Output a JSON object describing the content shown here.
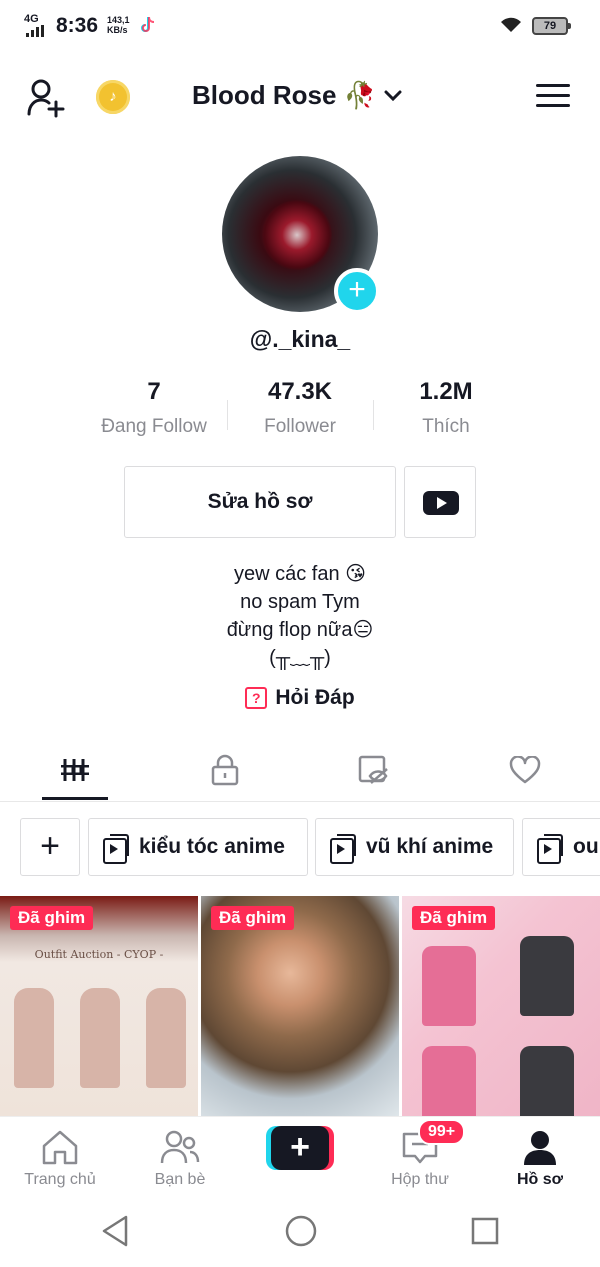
{
  "status_bar": {
    "network": "4G",
    "time": "8:36",
    "speed_value": "143,1",
    "speed_unit": "KB/s",
    "battery": "79"
  },
  "header": {
    "title": "Blood Rose 🥀"
  },
  "profile": {
    "username": "@._kina_",
    "stats": [
      {
        "value": "7",
        "label": "Đang Follow"
      },
      {
        "value": "47.3K",
        "label": "Follower"
      },
      {
        "value": "1.2M",
        "label": "Thích"
      }
    ],
    "edit_label": "Sửa hồ sơ",
    "bio": [
      "yew các fan 😘",
      "no spam Tym",
      "đừng flop nữa😑",
      "(╥﹏╥)"
    ],
    "qa_label": "Hỏi Đáp",
    "qa_icon": "?"
  },
  "playlists": [
    {
      "label": "kiểu tóc anime"
    },
    {
      "label": "vũ khí anime"
    },
    {
      "label": "ou"
    }
  ],
  "videos": [
    {
      "pinned": "Đã ghim",
      "caption": "Outfit Auction - CYOP -"
    },
    {
      "pinned": "Đã ghim"
    },
    {
      "pinned": "Đã ghim"
    }
  ],
  "bottom_nav": {
    "items": [
      {
        "label": "Trang chủ"
      },
      {
        "label": "Bạn bè"
      },
      {
        "label": "Hộp thư"
      },
      {
        "label": "Hồ sơ"
      }
    ],
    "create_label": "+",
    "inbox_badge": "99+"
  },
  "colors": {
    "accent_pink": "#fe2c55",
    "accent_cyan": "#20d5ec",
    "coin": "#f2c230",
    "text": "#161823",
    "muted": "#8a8b91"
  }
}
